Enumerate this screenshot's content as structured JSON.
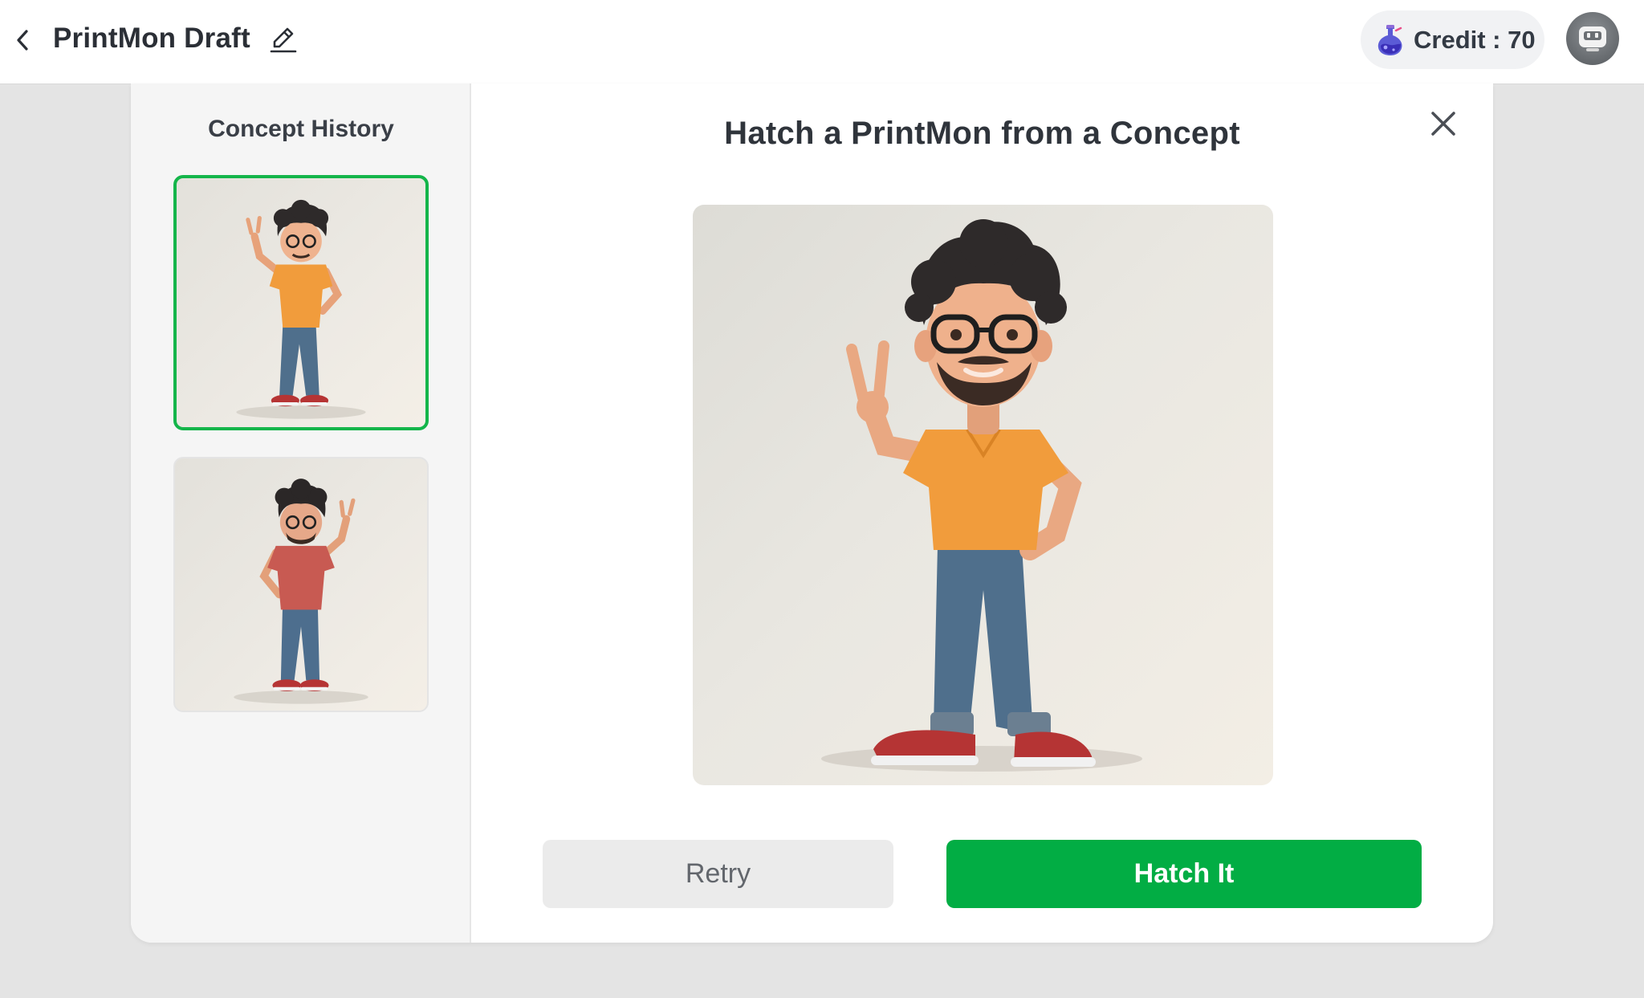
{
  "header": {
    "back_icon": "chevron-left-icon",
    "title": "PrintMon Draft",
    "edit_icon": "pencil-icon",
    "credit_icon": "potion-flask-icon",
    "credit_label": "Credit : 70",
    "avatar_icon": "robot-avatar-icon"
  },
  "history": {
    "title": "Concept History",
    "items": [
      {
        "shirt_color": "#f19c3c",
        "selected": true
      },
      {
        "shirt_color": "#c85a52",
        "selected": false
      }
    ]
  },
  "main": {
    "title": "Hatch a PrintMon from a Concept",
    "close_icon": "close-icon",
    "preview_shirt_color": "#f19c3c"
  },
  "actions": {
    "retry_label": "Retry",
    "hatch_label": "Hatch It"
  },
  "colors": {
    "accent_green": "#02ad44",
    "selected_border": "#14b54a"
  }
}
